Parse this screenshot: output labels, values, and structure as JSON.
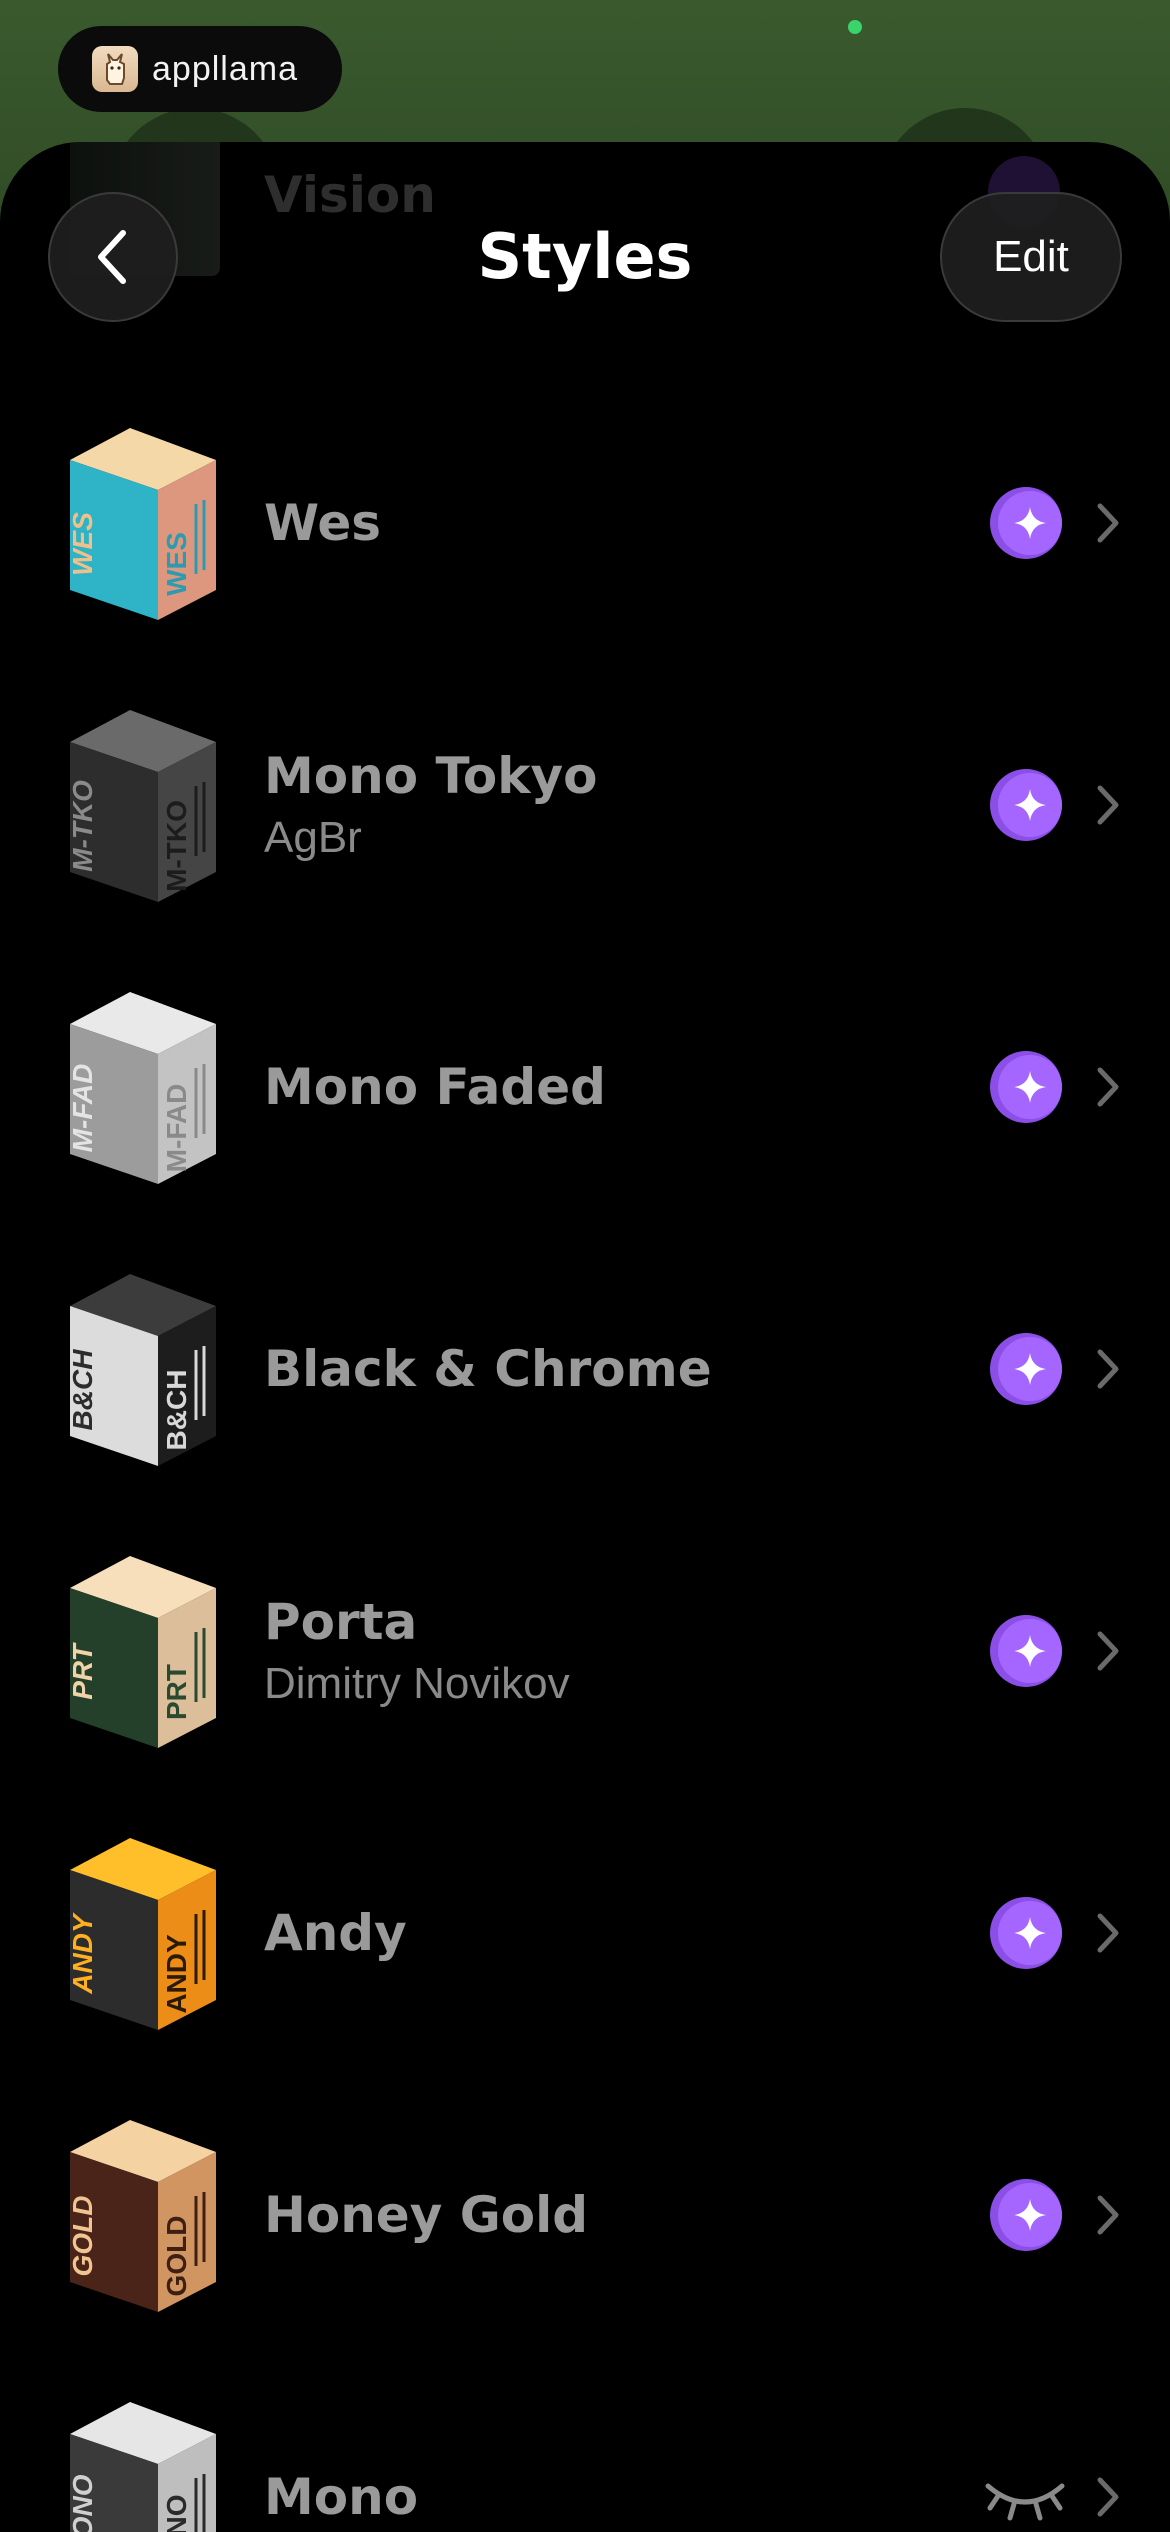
{
  "badge": {
    "text": "appllama"
  },
  "background": {
    "peek_title": "Vision"
  },
  "header": {
    "title": "Styles",
    "edit_label": "Edit"
  },
  "styles": [
    {
      "name": "Wes",
      "subtitle": "",
      "code": "WES",
      "top": "#f4d8a8",
      "left": "#2fb3c6",
      "right": "#f1a48a",
      "leftText": "#f0c08a",
      "rightText": "#2a9bb0",
      "status": "pro"
    },
    {
      "name": "Mono Tokyo",
      "subtitle": "AgBr",
      "code": "M-TKO",
      "top": "#6a6a6a",
      "left": "#2d2d2d",
      "right": "#4b4b4b",
      "leftText": "#8a8a8a",
      "rightText": "#1c1c1c",
      "status": "pro"
    },
    {
      "name": "Mono Faded",
      "subtitle": "",
      "code": "M-FAD",
      "top": "#e9e9e9",
      "left": "#9c9c9c",
      "right": "#d4d4d4",
      "leftText": "#e4e4e4",
      "rightText": "#8a8a8a",
      "status": "pro"
    },
    {
      "name": "Black & Chrome",
      "subtitle": "",
      "code": "B&CH",
      "top": "#3c3c3c",
      "left": "#dcdcdc",
      "right": "#202020",
      "leftText": "#2c2c2c",
      "rightText": "#d8d8d8",
      "status": "pro"
    },
    {
      "name": "Porta",
      "subtitle": "Dimitry Novikov",
      "code": "PRT",
      "top": "#f7dfbc",
      "left": "#24402a",
      "right": "#efcfa8",
      "leftText": "#eed4a8",
      "rightText": "#2a4a30",
      "status": "pro"
    },
    {
      "name": "Andy",
      "subtitle": "",
      "code": "ANDY",
      "top": "#ffbf2a",
      "left": "#2c2c2c",
      "right": "#ff9a1a",
      "leftText": "#ffb020",
      "rightText": "#2a1a05",
      "status": "pro"
    },
    {
      "name": "Honey Gold",
      "subtitle": "",
      "code": "GOLD",
      "top": "#f5d2a2",
      "left": "#4a2418",
      "right": "#e3a26a",
      "leftText": "#f1c592",
      "rightText": "#3e1f12",
      "status": "pro"
    },
    {
      "name": "Mono",
      "subtitle": "",
      "code": "MONO",
      "top": "#e6e6e6",
      "left": "#3a3a3a",
      "right": "#cfcfcf",
      "leftText": "#d0d0d0",
      "rightText": "#2a2a2a",
      "status": "hidden"
    }
  ],
  "colors": {
    "accent": "#8b4fe8",
    "accent_light": "#a566ff",
    "sheet": "#000000",
    "muted_text": "#9a9a9a"
  }
}
